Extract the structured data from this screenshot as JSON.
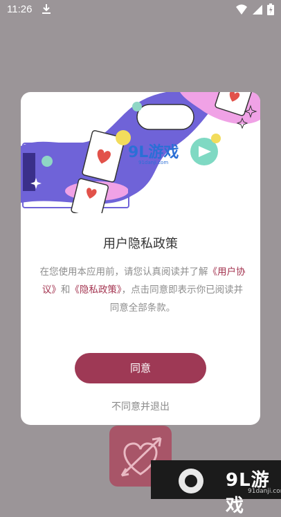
{
  "status_bar": {
    "time": "11:26"
  },
  "dialog": {
    "title": "用户隐私政策",
    "text_before": "在您使用本应用前，请您认真阅读并了解",
    "link_user_agreement": "《用户协议》",
    "text_and": "和",
    "link_privacy_policy": "《隐私政策》",
    "text_after": "，点击同意即表示你已阅读并同意全部条款。",
    "agree_label": "同意",
    "disagree_label": "不同意并退出"
  },
  "watermark": {
    "logo_text": "9L游戏",
    "url_text": "91danji.com"
  },
  "illustration_logo": {
    "text": "9L游戏",
    "url": "91danji.com"
  },
  "colors": {
    "accent": "#9e3955",
    "link": "#a3334f",
    "overlay": "#9b9598"
  }
}
